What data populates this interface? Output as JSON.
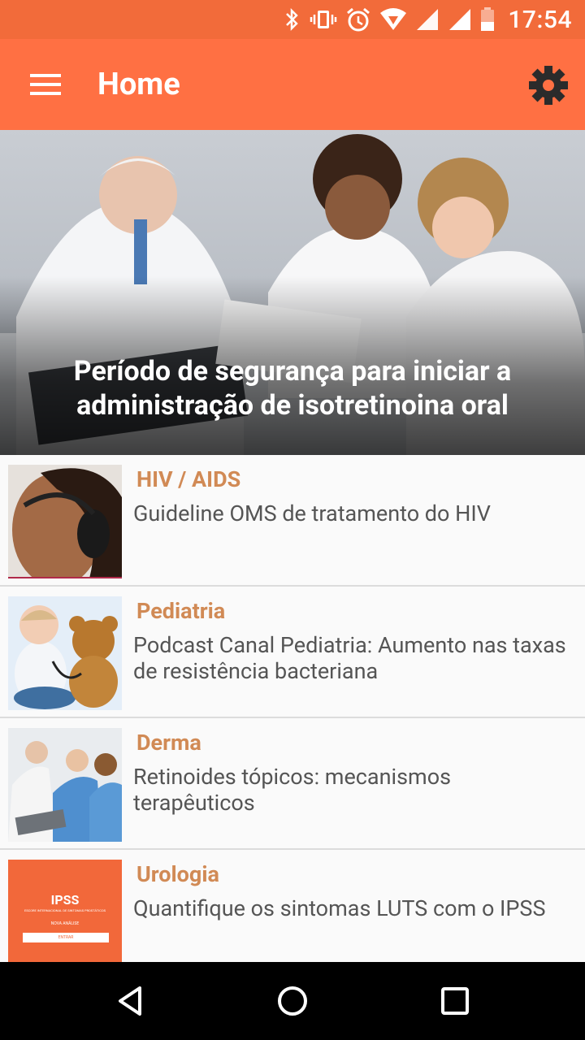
{
  "status_bar": {
    "time": "17:54"
  },
  "app_bar": {
    "title": "Home"
  },
  "hero": {
    "title": "Período de segurança para iniciar a administração de isotretinoina oral"
  },
  "articles": [
    {
      "category": "HIV / AIDS",
      "headline": "Guideline OMS de tratamento do HIV",
      "thumb": "woman-headphones-photo"
    },
    {
      "category": "Pediatria",
      "headline": "Podcast Canal Pediatria: Aumento nas taxas de resistência bacteriana",
      "thumb": "baby-teddy-bear-photo"
    },
    {
      "category": "Derma",
      "headline": "Retinoides tópicos: mecanismos terapêuticos",
      "thumb": "doctors-laptop-photo"
    },
    {
      "category": "Urologia",
      "headline": "Quantifique os sintomas LUTS com o IPSS",
      "thumb": "ipss-card",
      "thumb_text": {
        "title": "IPSS",
        "subtitle": "ESCORE INTERNACIONAL DE SINTOMAS PROSTÁTICOS",
        "caption": "NOVA ANÁLISE",
        "button": "ENTRAR"
      }
    }
  ],
  "colors": {
    "status_bar": "#f26b3a",
    "app_bar": "#ff7043",
    "category": "#d18a55",
    "headline": "#555555"
  }
}
